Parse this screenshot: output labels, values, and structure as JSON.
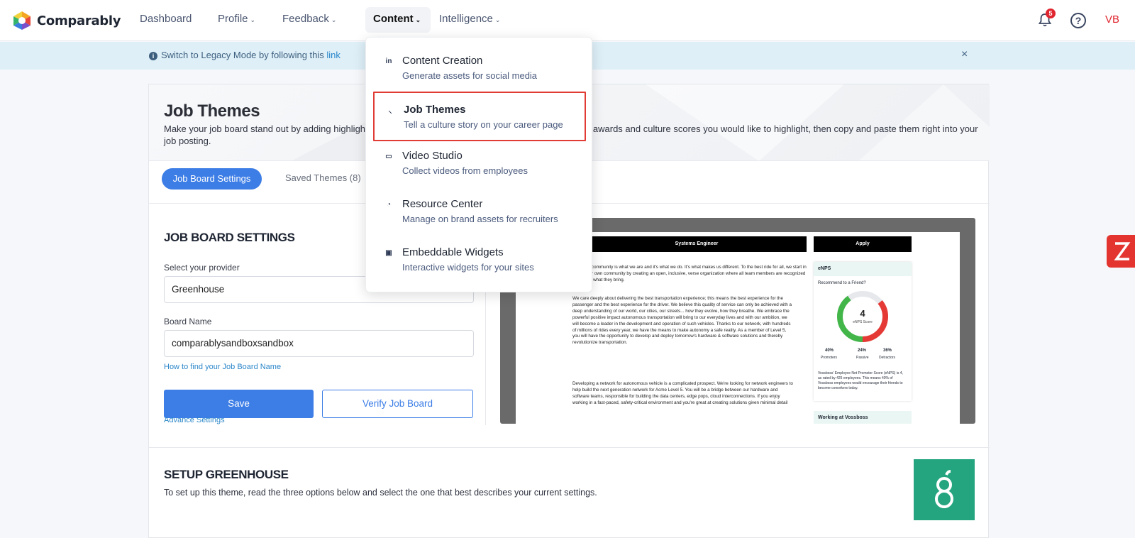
{
  "app": {
    "name": "Comparably"
  },
  "nav": {
    "items": [
      {
        "label": "Dashboard",
        "has_menu": false
      },
      {
        "label": "Profile",
        "has_menu": true
      },
      {
        "label": "Feedback",
        "has_menu": true
      },
      {
        "label": "Content",
        "has_menu": true,
        "active": true
      },
      {
        "label": "Intelligence",
        "has_menu": true
      }
    ],
    "chevron": "⌄",
    "notification_count": "5",
    "help_icon": "?",
    "user_initials": "VB"
  },
  "banner": {
    "text": "Switch to Legacy Mode by following this ",
    "link": "link",
    "close": "×"
  },
  "content_menu": {
    "items": [
      {
        "icon": "linkedin-icon",
        "icon_text": "in",
        "title": "Content Creation",
        "subtitle": "Generate assets for social media",
        "selected": false
      },
      {
        "icon": "magic-wand-icon",
        "icon_text": "⸜",
        "title": "Job Themes",
        "subtitle": "Tell a culture story on your career page",
        "selected": true
      },
      {
        "icon": "video-camera-icon",
        "icon_text": "▭",
        "title": "Video Studio",
        "subtitle": "Collect videos from employees",
        "selected": false
      },
      {
        "icon": "resource-icon",
        "icon_text": "◔",
        "title": "Resource Center",
        "subtitle": "Manage on brand assets for recruiters",
        "selected": false
      },
      {
        "icon": "image-icon",
        "icon_text": "▣",
        "title": "Embeddable Widgets",
        "subtitle": "Interactive widgets for your sites",
        "selected": false
      }
    ]
  },
  "page": {
    "title": "Job Themes",
    "description_part1": "Make your job board stand out by adding highlight",
    "description_part2": "awards and culture scores you would like to highlight, then copy and paste them right into your job posting."
  },
  "tabs": [
    {
      "label": "Job Board Settings",
      "active": true
    },
    {
      "label": "Saved Themes (8)",
      "active": false
    }
  ],
  "settings": {
    "section_title": "JOB BOARD SETTINGS",
    "provider_label": "Select your provider",
    "provider_value": "Greenhouse",
    "board_name_label": "Board Name",
    "board_name_value": "comparablysandboxsandbox",
    "help_link": "How to find your Job Board Name",
    "save_label": "Save",
    "verify_label": "Verify Job Board",
    "advanced_link": "Advance Settings"
  },
  "preview": {
    "job_title": "Systems Engineer",
    "apply": "Apply",
    "para1": "e, community is what we are and it's what we do. It's what makes us different. To the best ride for all, we start in our own community by creating an open, inclusive, verse organization where all team members are recognized for what they bring.",
    "para2": "We care deeply about delivering the best transportation experience; this means the best experience for the passenger and the best experience for the driver. We believe this quality of service can only be achieved with a deep understanding of our world, our cities, our streets... how they evolve, how they breathe. We embrace the powerful positive impact autonomous transportation will bring to our everyday lives and with our ambition, we will become a leader in the development and operation of such vehicles. Thanks to our network, with hundreds of millions of rides every year, we have the means to make autonomy a safe reality. As a member of Level 5, you will have the opportunity to develop and deploy tomorrow's hardware & software solutions and thereby revolutionize transportation.",
    "para3": "Developing a network for autonomous vehicle is a complicated prospect. We're looking for network engineers to help build the next generation network for Acme Level 5. You will be a bridge between our hardware and software teams, responsible for building the data centers, edge pops, cloud interconnections. If you enjoy working in a fast-paced, safety-critical environment and you're great at creating solutions given minimal detail",
    "enps": {
      "title": "eNPS",
      "question": "Recommend to a Friend?",
      "score": "4",
      "score_label": "eNPS Score",
      "promoters_pct": "40%",
      "passive_pct": "24%",
      "detractors_pct": "36%",
      "promoters": "Promoters",
      "passive": "Passive",
      "detractors": "Detractors",
      "promoters_value": 0.4,
      "passive_value": 0.24,
      "detractors_value": 0.36,
      "caption": "Vossboss' Employee Net Promoter Score (eNPS) is 4, as rated by 425 employees. This means 40% of Vossboss employees would encourage their friends to become coworkers today."
    },
    "panel2_title": "Working at Vossboss"
  },
  "setup": {
    "title": "SETUP GREENHOUSE",
    "description": "To set up this theme, read the three options below and select the one that best describes your current settings.",
    "logo_letter": "g"
  },
  "colors": {
    "primary": "#3c7de6",
    "highlight": "#e03b35",
    "greenhouse": "#24a47f",
    "banner": "#deeff8"
  }
}
